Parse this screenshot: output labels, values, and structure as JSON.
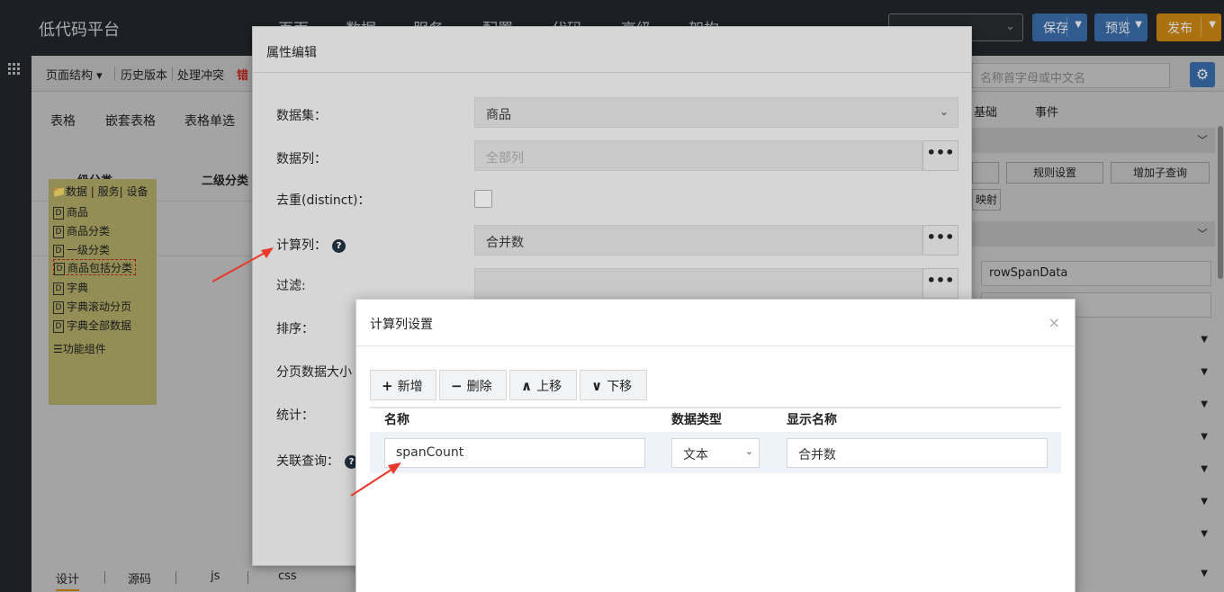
{
  "app": {
    "title": "低代码平台",
    "nav": [
      "页面",
      "数据",
      "服务",
      "配置",
      "代码",
      "高级",
      "架构"
    ],
    "page_select": "…",
    "save_label": "保存",
    "preview_label": "预览",
    "publish_label": "发布"
  },
  "toolbar": {
    "page_structure": "页面结构",
    "history": "历史版本",
    "conflict": "处理冲突",
    "error": "错"
  },
  "component_tabs": [
    "表格",
    "嵌套表格",
    "表格单选"
  ],
  "grid_headers": [
    "一级分类",
    "二级分类"
  ],
  "data_tree": {
    "root": "数据 | 服务| 设备",
    "items": [
      "商品",
      "商品分类",
      "一级分类",
      "商品包括分类",
      "字典",
      "字典滚动分页",
      "字典全部数据"
    ],
    "selected_index": 3,
    "functions": "功能组件"
  },
  "bottom_tabs": [
    "设计",
    "源码",
    "js",
    "css"
  ],
  "right_panel": {
    "search_placeholder": "名称首字母或中文名",
    "tabs": [
      "基础",
      "事件"
    ],
    "buttons": [
      "规则设置",
      "增加子查询"
    ],
    "mapping": "映射",
    "row_span_field": "rowSpanData"
  },
  "attr_dialog": {
    "title": "属性编辑",
    "fields": {
      "dataset_label": "数据集：",
      "dataset_value": "商品",
      "datacol_label": "数据列：",
      "datacol_placeholder": "全部列",
      "distinct_label": "去重(distinct)：",
      "calc_label": "计算列：",
      "calc_value": "合并数",
      "filter_label": "过滤:",
      "sort_label": "排序：",
      "pagesize_label": "分页数据大小",
      "stats_label": "统计：",
      "join_label": "关联查询："
    },
    "more_label": "•••"
  },
  "calc_dialog": {
    "title": "计算列设置",
    "buttons": {
      "add": "新增",
      "delete": "删除",
      "up": "上移",
      "down": "下移"
    },
    "columns": [
      "名称",
      "数据类型",
      "显示名称"
    ],
    "rows": [
      {
        "name": "spanCount",
        "type": "文本",
        "display": "合并数"
      }
    ]
  }
}
